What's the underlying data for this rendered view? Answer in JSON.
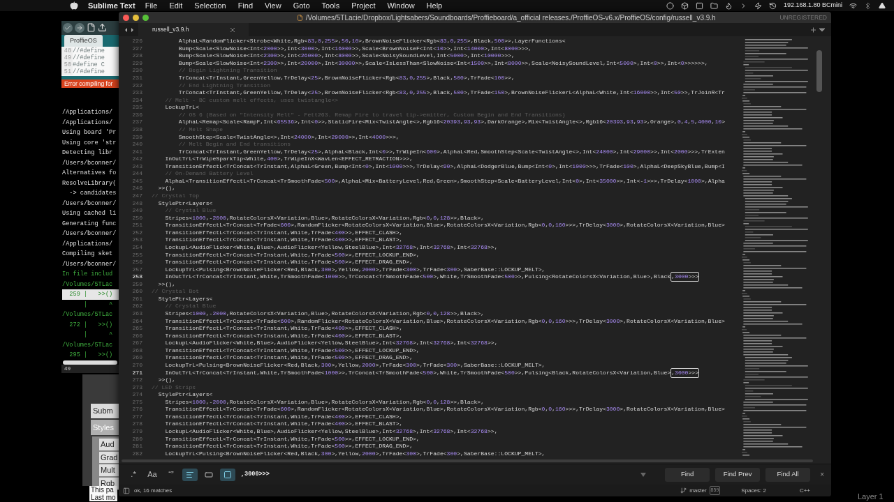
{
  "menubar": {
    "app": "Sublime Text",
    "menus": [
      "File",
      "Edit",
      "Selection",
      "Find",
      "View",
      "Goto",
      "Tools",
      "Project",
      "Window",
      "Help"
    ],
    "network": "192.168.1.80 BCmini"
  },
  "background_window": {
    "tab": "ProffieOS",
    "code": [
      {
        "n": "48",
        "text": "//#define"
      },
      {
        "n": "49",
        "text": "//#define"
      },
      {
        "n": "50",
        "text": "#define C"
      },
      {
        "n": "51",
        "text": "//#define"
      }
    ],
    "error": "Error compiling for",
    "console": [
      {
        "kind": "plain",
        "text": "/Applications/"
      },
      {
        "kind": "plain",
        "text": "/Applications/"
      },
      {
        "kind": "plain",
        "text": "Using board 'Pr"
      },
      {
        "kind": "plain",
        "text": "Using core 'str"
      },
      {
        "kind": "plain",
        "text": "Detecting libr"
      },
      {
        "kind": "plain",
        "text": "/Users/bconner/"
      },
      {
        "kind": "plain",
        "text": "Alternatives fo"
      },
      {
        "kind": "plain",
        "text": "ResolveLibrary("
      },
      {
        "kind": "plain",
        "text": "  -> candidates"
      },
      {
        "kind": "plain",
        "text": "/Users/bconner/"
      },
      {
        "kind": "plain",
        "text": "Using cached li"
      },
      {
        "kind": "plain",
        "text": "Generating func"
      },
      {
        "kind": "plain",
        "text": "/Users/bconner/"
      },
      {
        "kind": "plain",
        "text": "/Applications/"
      },
      {
        "kind": "plain",
        "text": "Compiling sket"
      },
      {
        "kind": "plain",
        "text": "/Users/bconner/"
      },
      {
        "kind": "green",
        "text": "In file includ"
      },
      {
        "kind": "green",
        "text": "/Volumes/5TLac"
      },
      {
        "kind": "highlight",
        "text": "  259 |   >>()"
      },
      {
        "kind": "green",
        "text": "      |      ^"
      },
      {
        "kind": "green",
        "text": "/Volumes/5TLac"
      },
      {
        "kind": "green",
        "text": "  272 |   >>()"
      },
      {
        "kind": "green",
        "text": "      |      ^"
      },
      {
        "kind": "green",
        "text": "/Volumes/5TLac"
      },
      {
        "kind": "green",
        "text": "  295 |   >>()"
      }
    ],
    "line_indicator": "49",
    "web_page": {
      "button": "Subm",
      "tab": "Styles",
      "items": [
        "Aud",
        "Grad",
        "Mult",
        "Rgb"
      ],
      "footer": [
        "This pa",
        "Last mo"
      ]
    }
  },
  "window": {
    "title": "/Volumes/5TLacie/Dropbox/Lightsabers/Soundboards/Proffieboard/a_official releases./ProffieOS-v6.x/ProffieOS/config/russell_v3.9.h",
    "license": "UNREGISTERED",
    "tab": "russell_v3.9.h"
  },
  "editor": {
    "lines": [
      {
        "n": "226",
        "kind": "code",
        "current": false,
        "text": "        AlphaL<RandomFlicker<Strobe<White,Rgb<83,0,255>,50,10>,BrownNoiseFlicker<Rgb<83,0,255>,Black,500>>,LayerFunctions<"
      },
      {
        "n": "227",
        "kind": "code",
        "current": false,
        "text": "        Bump<Scale<SlowNoise<Int<2000>>,Int<3000>,Int<16000>>,Scale<BrownNoiseF<Int<10>>,Int<14000>,Int<8000>>>,"
      },
      {
        "n": "228",
        "kind": "code",
        "current": false,
        "text": "        Bump<Scale<SlowNoise<Int<2300>>,Int<26000>,Int<8000>>,Scale<NoisySoundLevel,Int<5000>,Int<10000>>>,"
      },
      {
        "n": "229",
        "kind": "code",
        "current": false,
        "text": "        Bump<Scale<SlowNoise<Int<2300>>,Int<20000>,Int<30000>>,Scale<IsLessThan<SlowNoise<Int<1500>>,Int<8000>>,Scale<NoisySoundLevel,Int<5000>,Int<0>>,Int<0>>>>>>,"
      },
      {
        "n": "230",
        "kind": "comment",
        "current": false,
        "text": "        // Begin Lightning Transition"
      },
      {
        "n": "231",
        "kind": "code",
        "current": false,
        "text": "        TrConcat<TrInstant,GreenYellow,TrDelay<25>,BrownNoiseFlicker<Rgb<83,0,255>,Black,500>,TrFade<100>>,"
      },
      {
        "n": "232",
        "kind": "comment",
        "current": false,
        "text": "        // End Lightning Transition"
      },
      {
        "n": "233",
        "kind": "code",
        "current": false,
        "text": "        TrConcat<TrInstant,GreenYellow,TrDelay<25>,BrownNoiseFlicker<Rgb<83,0,255>,Black,500>,TrFade<150>,BrownNoiseFlickerL<AlphaL<White,Int<16000>>,Int<50>>,TrJoinR<Tr"
      },
      {
        "n": "234",
        "kind": "comment",
        "current": false,
        "text": "    // Melt - BC custom melt effects, uses twistangle<>"
      },
      {
        "n": "235",
        "kind": "code",
        "current": false,
        "text": "    LockupTrL<"
      },
      {
        "n": "236",
        "kind": "comment",
        "current": false,
        "text": "        // OS 6 (Based on \"Intensity Melt\" - Fett263. Remap Fire to travel tip->emitter, Custom Begin and End Transitions)"
      },
      {
        "n": "237",
        "kind": "code",
        "current": false,
        "text": "        AlphaL<Remap<Scale<RampF,Int<65536>,Int<0>>,StaticFire<Mix<TwistAngle<>,Rgb16<20393,93,93>,DarkOrange>,Mix<TwistAngle<>,Rgb16<20393,93,93>,Orange>,0,4,5,4000,10>"
      },
      {
        "n": "238",
        "kind": "comment",
        "current": false,
        "text": "        // Melt Shape"
      },
      {
        "n": "239",
        "kind": "code",
        "current": false,
        "text": "        SmoothStep<Scale<TwistAngle<>,Int<24000>,Int<29000>>,Int<4000>>>,"
      },
      {
        "n": "240",
        "kind": "comment",
        "current": false,
        "text": "        // Melt Begin and End transitions"
      },
      {
        "n": "241",
        "kind": "code",
        "current": false,
        "text": "        TrConcat<TrInstant,GreenYellow,TrDelay<25>,AlphaL<Black,Int<0>>,TrWipeIn<600>,AlphaL<Red,SmoothStep<Scale<TwistAngle<>,Int<24000>,Int<29000>>,Int<2000>>>,TrExten"
      },
      {
        "n": "242",
        "kind": "code",
        "current": false,
        "text": "    InOutTrL<TrWipeSparkTip<White,400>,TrWipeInX<WavLen<EFFECT_RETRACTION>>>,"
      },
      {
        "n": "243",
        "kind": "code",
        "current": false,
        "text": "    TransitionEffectL<TrConcat<TrInstant,AlphaL<Green,Bump<Int<0>,Int<1000>>>,TrDelay<90>,AlphaL<DodgerBlue,Bump<Int<0>,Int<1000>>>,TrFade<100>,AlphaL<DeepSkyBlue,Bump<I"
      },
      {
        "n": "244",
        "kind": "comment",
        "current": false,
        "text": "    // On-Demand Battery Level"
      },
      {
        "n": "245",
        "kind": "code",
        "current": false,
        "text": "    AlphaL<TransitionEffectL<TrConcat<TrSmoothFade<500>,AlphaL<Mix<BatteryLevel,Red,Green>,SmoothStep<Scale<BatteryLevel,Int<0>,Int<35000>>,Int<-1>>>,TrDelay<1000>,Alpha"
      },
      {
        "n": "246",
        "kind": "code",
        "current": false,
        "text": "  >>(),"
      },
      {
        "n": "247",
        "kind": "comment",
        "current": false,
        "text": "// Crystal Top"
      },
      {
        "n": "248",
        "kind": "code",
        "current": false,
        "text": "  StylePtr<Layers<"
      },
      {
        "n": "249",
        "kind": "comment",
        "current": false,
        "text": "    // Crystal Blue"
      },
      {
        "n": "250",
        "kind": "code",
        "current": false,
        "text": "    Stripes<1000,-2000,RotateColorsX<Variation,Blue>,RotateColorsX<Variation,Rgb<0,0,128>>,Black>,"
      },
      {
        "n": "251",
        "kind": "code",
        "current": false,
        "text": "    TransitionEffectL<TrConcat<TrFade<600>,RandomFlicker<RotateColorsX<Variation,Blue>,RotateColorsX<Variation,Rgb<0,0,160>>>,TrDelay<3000>,RotateColorsX<Variation,Blue>"
      },
      {
        "n": "252",
        "kind": "code",
        "current": false,
        "text": "    TransitionEffectL<TrConcat<TrInstant,White,TrFade<400>>,EFFECT_CLASH>,"
      },
      {
        "n": "253",
        "kind": "code",
        "current": false,
        "text": "    TransitionEffectL<TrConcat<TrInstant,White,TrFade<400>>,EFFECT_BLAST>,"
      },
      {
        "n": "254",
        "kind": "code",
        "current": false,
        "text": "    LockupL<AudioFlicker<White,Blue>,AudioFlicker<Yellow,SteelBlue>,Int<32768>,Int<32768>,Int<32768>>,"
      },
      {
        "n": "255",
        "kind": "code",
        "current": false,
        "text": "    TransitionEffectL<TrConcat<TrInstant,White,TrFade<500>>,EFFECT_LOCKUP_END>,"
      },
      {
        "n": "256",
        "kind": "code",
        "current": false,
        "text": "    TransitionEffectL<TrConcat<TrInstant,White,TrFade<500>>,EFFECT_DRAG_END>,"
      },
      {
        "n": "257",
        "kind": "code",
        "current": false,
        "text": "    LockupTrL<Pulsing<BrownNoiseFlicker<Red,Black,300>,Yellow,2000>,TrFade<300>,TrFade<300>,SaberBase::LOCKUP_MELT>,"
      },
      {
        "n": "258",
        "kind": "code",
        "current": true,
        "text": "    InOutTrL<TrConcat<TrInstant,White,TrSmoothFade<1000>>,TrConcat<TrSmoothFade<500>,White,TrSmoothFade<500>>,Pulsing<RotateColorsX<Variation,Blue>,Black",
        "match": ",3000>>>"
      },
      {
        "n": "259",
        "kind": "code",
        "current": false,
        "text": "  >>(),"
      },
      {
        "n": "260",
        "kind": "comment",
        "current": false,
        "text": "// Crystal Bot"
      },
      {
        "n": "261",
        "kind": "code",
        "current": false,
        "text": "  StylePtr<Layers<"
      },
      {
        "n": "262",
        "kind": "comment",
        "current": false,
        "text": "    // Crystal Blue"
      },
      {
        "n": "263",
        "kind": "code",
        "current": false,
        "text": "    Stripes<1000,-2000,RotateColorsX<Variation,Blue>,RotateColorsX<Variation,Rgb<0,0,128>>,Black>,"
      },
      {
        "n": "264",
        "kind": "code",
        "current": false,
        "text": "    TransitionEffectL<TrConcat<TrFade<600>,RandomFlicker<RotateColorsX<Variation,Blue>,RotateColorsX<Variation,Rgb<0,0,160>>>,TrDelay<3000>,RotateColorsX<Variation,Blue>"
      },
      {
        "n": "265",
        "kind": "code",
        "current": false,
        "text": "    TransitionEffectL<TrConcat<TrInstant,White,TrFade<400>>,EFFECT_CLASH>,"
      },
      {
        "n": "266",
        "kind": "code",
        "current": false,
        "text": "    TransitionEffectL<TrConcat<TrInstant,White,TrFade<400>>,EFFECT_BLAST>,"
      },
      {
        "n": "267",
        "kind": "code",
        "current": false,
        "text": "    LockupL<AudioFlicker<White,Blue>,AudioFlicker<Yellow,SteelBlue>,Int<32768>,Int<32768>,Int<32768>>,"
      },
      {
        "n": "268",
        "kind": "code",
        "current": false,
        "text": "    TransitionEffectL<TrConcat<TrInstant,White,TrFade<500>>,EFFECT_LOCKUP_END>,"
      },
      {
        "n": "269",
        "kind": "code",
        "current": false,
        "text": "    TransitionEffectL<TrConcat<TrInstant,White,TrFade<500>>,EFFECT_DRAG_END>,"
      },
      {
        "n": "270",
        "kind": "code",
        "current": false,
        "text": "    LockupTrL<Pulsing<BrownNoiseFlicker<Red,Black,300>,Yellow,2000>,TrFade<300>,TrFade<300>,SaberBase::LOCKUP_MELT>,"
      },
      {
        "n": "271",
        "kind": "code",
        "current": true,
        "text": "    InOutTrL<TrConcat<TrInstant,White,TrSmoothFade<1000>>,TrConcat<TrSmoothFade<500>,White,TrSmoothFade<500>>,Pulsing<Black,RotateColorsX<Variation,Blue>",
        "match": ",3000>>>"
      },
      {
        "n": "272",
        "kind": "code",
        "current": false,
        "text": "  >>(),"
      },
      {
        "n": "273",
        "kind": "comment",
        "current": false,
        "text": "// LED Strips"
      },
      {
        "n": "274",
        "kind": "code",
        "current": false,
        "text": "  StylePtr<Layers<"
      },
      {
        "n": "275",
        "kind": "code",
        "current": false,
        "text": "    Stripes<1000,-2000,RotateColorsX<Variation,Blue>,RotateColorsX<Variation,Rgb<0,0,128>>,Black>,"
      },
      {
        "n": "276",
        "kind": "code",
        "current": false,
        "text": "    TransitionEffectL<TrConcat<TrFade<600>,RandomFlicker<RotateColorsX<Variation,Blue>,RotateColorsX<Variation,Rgb<0,0,160>>>,TrDelay<3000>,RotateColorsX<Variation,Blue>"
      },
      {
        "n": "277",
        "kind": "code",
        "current": false,
        "text": "    TransitionEffectL<TrConcat<TrInstant,White,TrFade<400>>,EFFECT_CLASH>,"
      },
      {
        "n": "278",
        "kind": "code",
        "current": false,
        "text": "    TransitionEffectL<TrConcat<TrInstant,White,TrFade<400>>,EFFECT_BLAST>,"
      },
      {
        "n": "279",
        "kind": "code",
        "current": false,
        "text": "    LockupL<AudioFlicker<White,Blue>,AudioFlicker<Yellow,SteelBlue>,Int<32768>,Int<32768>,Int<32768>>,"
      },
      {
        "n": "280",
        "kind": "code",
        "current": false,
        "text": "    TransitionEffectL<TrConcat<TrInstant,White,TrFade<500>>,EFFECT_LOCKUP_END>,"
      },
      {
        "n": "281",
        "kind": "code",
        "current": false,
        "text": "    TransitionEffectL<TrConcat<TrInstant,White,TrFade<500>>,EFFECT_DRAG_END>,"
      },
      {
        "n": "282",
        "kind": "code",
        "current": false,
        "text": "    LockupTrL<Pulsing<BrownNoiseFlicker<Red,Black,300>,Yellow,2000>,TrFade<300>,TrFade<300>,SaberBase::LOCKUP_MELT>,"
      }
    ]
  },
  "find_panel": {
    "options": [
      {
        "kind": "text",
        "label": ".*",
        "on": false
      },
      {
        "kind": "text",
        "label": "Aa",
        "on": false
      },
      {
        "kind": "text",
        "label": "“”",
        "on": false
      },
      {
        "kind": "wrap",
        "on": true
      },
      {
        "kind": "in-selection",
        "on": false
      },
      {
        "kind": "highlight",
        "on": true
      }
    ],
    "query": ",3000>>>",
    "buttons": [
      "Find",
      "Find Prev",
      "Find All"
    ],
    "close": "×"
  },
  "status_bar": {
    "message": "ok, 16 matches",
    "branch": "master",
    "changes": "859",
    "indent": "Spaces: 2",
    "syntax": "C++"
  },
  "desktop_label": "Layer 1"
}
